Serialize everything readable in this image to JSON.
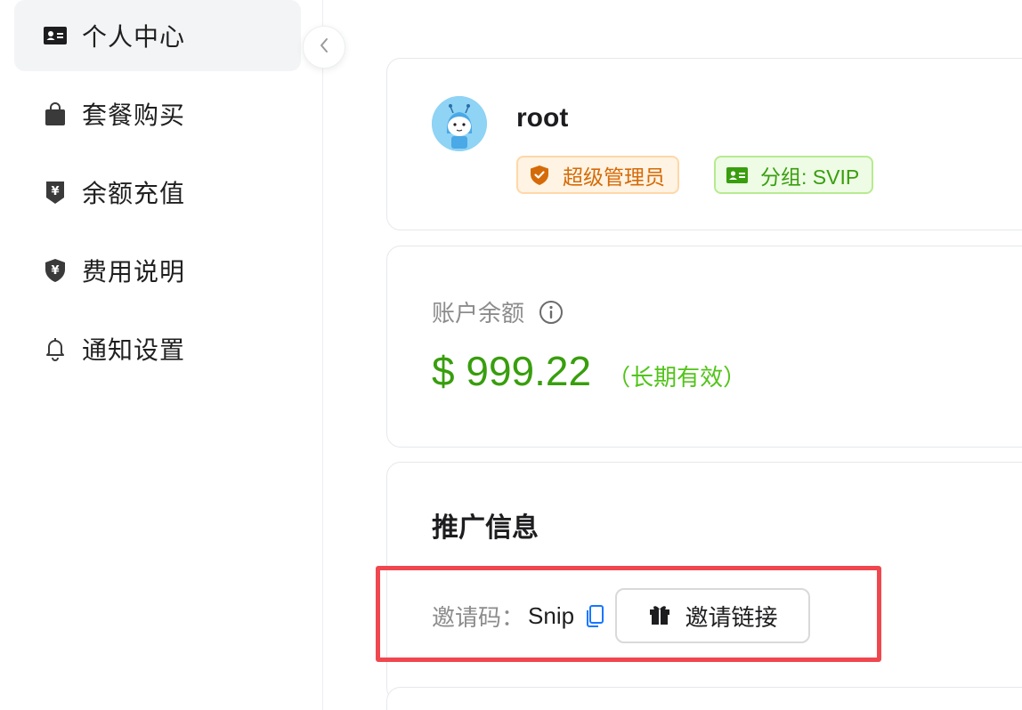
{
  "sidebar": {
    "items": [
      {
        "label": "个人中心",
        "icon": "id-card-icon",
        "active": true
      },
      {
        "label": "套餐购买",
        "icon": "shopping-bag-icon",
        "active": false
      },
      {
        "label": "余额充值",
        "icon": "yen-badge-icon",
        "active": false
      },
      {
        "label": "费用说明",
        "icon": "yen-shield-icon",
        "active": false
      },
      {
        "label": "通知设置",
        "icon": "bell-icon",
        "active": false
      }
    ],
    "collapse_icon": "chevron-left-icon"
  },
  "profile": {
    "username": "root",
    "role_tag": "超级管理员",
    "group_tag": "分组: SVIP",
    "colors": {
      "role": "#d46b08",
      "group": "#389e0d"
    }
  },
  "balance": {
    "label": "账户余额",
    "amount": "$ 999.22",
    "note": "（长期有效）",
    "color": "#389e0d"
  },
  "promotion": {
    "title": "推广信息",
    "invite_label": "邀请码：",
    "invite_code": "Snip",
    "invite_button": "邀请链接"
  },
  "annotation": {
    "color": "#f0474f"
  }
}
